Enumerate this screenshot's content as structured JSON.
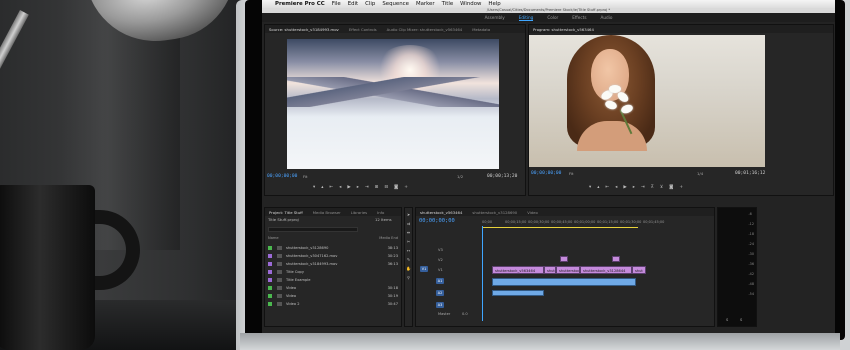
{
  "menubar": {
    "app": "Premiere Pro CC",
    "items": [
      "File",
      "Edit",
      "Clip",
      "Sequence",
      "Marker",
      "Title",
      "Window",
      "Help"
    ]
  },
  "path": "/Users/Casual/Cities/Documents/Premiere Stock/ie/Title Stuff.prproj *",
  "workspaces": [
    "Assembly",
    "Editing",
    "Color",
    "Effects",
    "Audio"
  ],
  "active_workspace": "Editing",
  "source": {
    "tabs": [
      "Source: shutterstock_v3184993.mov",
      "Effect Controls",
      "Audio Clip Mixer: shutterstock_v563464",
      "Metadata"
    ],
    "timecode_left": "00;00;00;00",
    "fit": "Fit",
    "page": "1/2",
    "timecode_right": "00;00;13;20"
  },
  "program": {
    "tab": "Program: shutterstock_v563464",
    "timecode_left": "00;00;00;00",
    "fit": "Fit",
    "page": "1/4",
    "timecode_right": "00;01;16;12"
  },
  "project": {
    "tabs": [
      "Project: Title Stuff",
      "Media Browser",
      "Libraries",
      "Info"
    ],
    "title": "Title Stuff.prproj",
    "count": "12 Items",
    "col_name": "Name",
    "col_dur": "Media End",
    "items": [
      {
        "name": "shutterstock_v3128690",
        "dur": "38:13",
        "color": "#4bb84f"
      },
      {
        "name": "shutterstock_v3047162.mov",
        "dur": "30:23",
        "color": "#9b6ad6"
      },
      {
        "name": "shutterstock_v3184993.mov",
        "dur": "36:13",
        "color": "#9b6ad6"
      },
      {
        "name": "Title Copy",
        "dur": "",
        "color": "#9b6ad6"
      },
      {
        "name": "Title Example",
        "dur": "",
        "color": "#9b6ad6"
      },
      {
        "name": "Video",
        "dur": "30:18",
        "color": "#4bb84f"
      },
      {
        "name": "Video",
        "dur": "30:19",
        "color": "#4bb84f"
      },
      {
        "name": "Video 2",
        "dur": "30:47",
        "color": "#4bb84f"
      }
    ]
  },
  "timeline": {
    "tabs": [
      "shutterstock_v563464",
      "shutterstock_v3128690",
      "Video"
    ],
    "timecode": "00;00;00;00",
    "ruler": [
      "00;00",
      "00;00;15;00",
      "00;00;30;00",
      "00;00;45;00",
      "00;01;00;00",
      "00;01;15;00",
      "00;01;30;00",
      "00;01;45;00"
    ],
    "video_tracks": [
      "V3",
      "V2",
      "V1"
    ],
    "audio_tracks": [
      "A1",
      "A2",
      "A3"
    ],
    "master_label": "Master",
    "master_value": "0.0",
    "clips_v1": [
      "shutterstock_v563464",
      "shut",
      "shutterstock_v3128690",
      "shutterstock_v3128644",
      "shut"
    ],
    "meter_scale": [
      "-6",
      "-12",
      "-18",
      "-24",
      "-30",
      "-36",
      "-42",
      "-48",
      "-54"
    ],
    "meter_bottom": [
      "S",
      "S"
    ]
  },
  "colors": {
    "accent": "#3fa6ff",
    "video_clip": "#c58bdc",
    "audio_clip": "#6fa9e6"
  }
}
